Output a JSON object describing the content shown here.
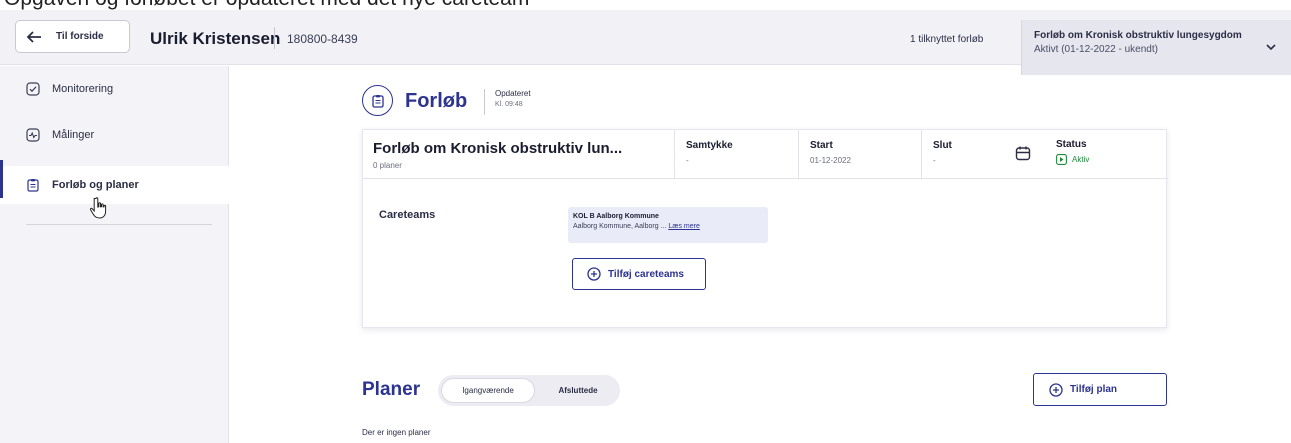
{
  "caption": "Opgaven og forløbet er opdateret med det nye careteam",
  "topbar": {
    "back_label": "Til forside",
    "patient_name": "Ulrik Kristensen",
    "patient_id": "180800-8439",
    "linked_count": "1 tilknyttet forløb",
    "course_title": "Forløb om Kronisk obstruktiv lungesygdom",
    "course_status": "Aktivt (01-12-2022 - ukendt)"
  },
  "sidebar": {
    "items": [
      {
        "label": "Monitorering",
        "icon": "check-square-icon"
      },
      {
        "label": "Målinger",
        "icon": "pulse-icon"
      },
      {
        "label": "Forløb og planer",
        "icon": "clipboard-icon",
        "active": true
      }
    ]
  },
  "page": {
    "title": "Forløb",
    "updated_label": "Opdateret",
    "updated_time": "Kl. 09:48"
  },
  "course": {
    "title": "Forløb om Kronisk obstruktiv lun...",
    "plans_count": "0 planer",
    "consent_label": "Samtykke",
    "consent_value": "-",
    "start_label": "Start",
    "start_value": "01-12-2022",
    "end_label": "Slut",
    "end_value": "-",
    "status_label": "Status",
    "status_value": "Aktiv"
  },
  "careteams": {
    "label": "Careteams",
    "team_name": "KOL B Aalborg Kommune",
    "team_address": "Aalborg Kommune, Aalborg ...",
    "read_more": "Læs mere",
    "add_label": "Tilføj careteams"
  },
  "plans": {
    "title": "Planer",
    "tab_active": "Igangværende",
    "tab_inactive": "Afsluttede",
    "add_label": "Tilføj plan",
    "empty_text": "Der er ingen planer"
  },
  "colors": {
    "primary": "#2c3390",
    "status_green": "#1f8a3b",
    "sidebar_bg": "#f4f4f8",
    "topbar_bg": "#f1f1f6"
  }
}
